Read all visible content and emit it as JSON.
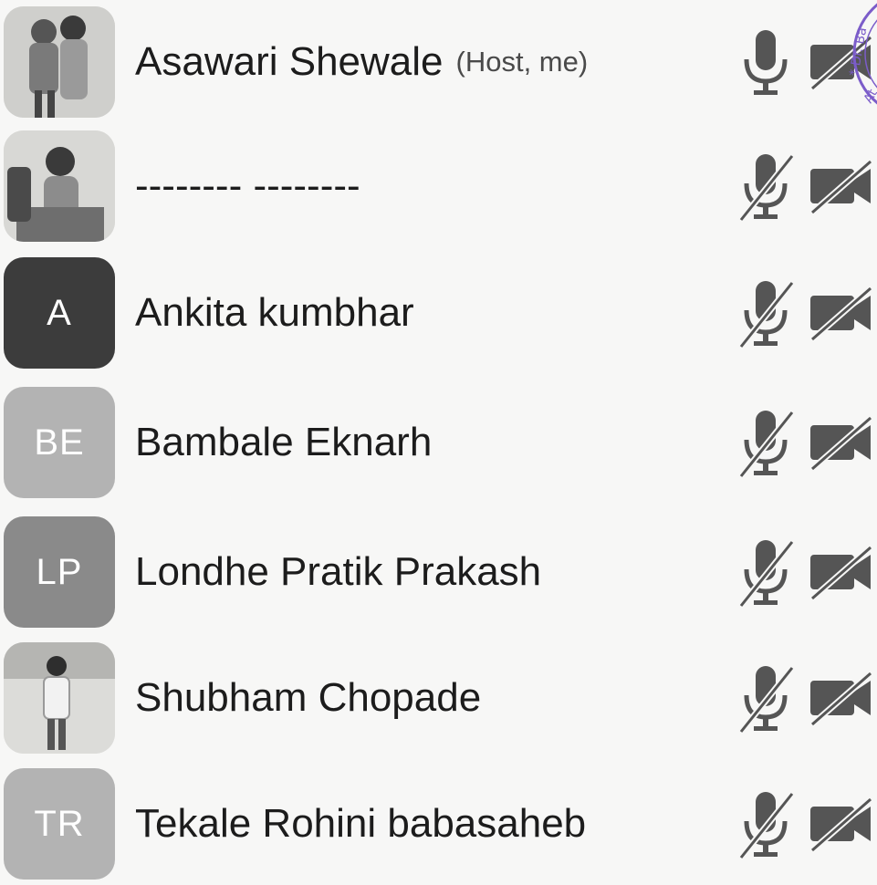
{
  "participants": [
    {
      "name": "Asawari Shewale",
      "tag": "(Host, me)",
      "avatar": "photo",
      "mic": "unmuted",
      "video": "off"
    },
    {
      "name": "-------- --------",
      "tag": "",
      "avatar": "photo",
      "mic": "muted",
      "video": "off"
    },
    {
      "name": "Ankita kumbhar",
      "tag": "",
      "avatar": "initials",
      "initials": "A",
      "avatar_color": "#3c3c3c",
      "mic": "muted",
      "video": "off"
    },
    {
      "name": "Bambale Eknarh",
      "tag": "",
      "avatar": "initials",
      "initials": "BE",
      "avatar_color": "#b3b3b3",
      "mic": "muted",
      "video": "off"
    },
    {
      "name": "Londhe Pratik Prakash",
      "tag": "",
      "avatar": "initials",
      "initials": "LP",
      "avatar_color": "#8a8a8a",
      "mic": "muted",
      "video": "off"
    },
    {
      "name": "Shubham Chopade",
      "tag": "",
      "avatar": "photo",
      "mic": "muted",
      "video": "off"
    },
    {
      "name": "Tekale Rohini babasaheb",
      "tag": "",
      "avatar": "initials",
      "initials": "TR",
      "avatar_color": "#b3b3b3",
      "mic": "muted",
      "video": "off"
    }
  ],
  "icons": {
    "mic_unmuted": "microphone-icon",
    "mic_muted": "microphone-muted-icon",
    "video_off": "video-off-icon"
  },
  "stamp": {
    "text": "* Dr. Ba... At..."
  }
}
